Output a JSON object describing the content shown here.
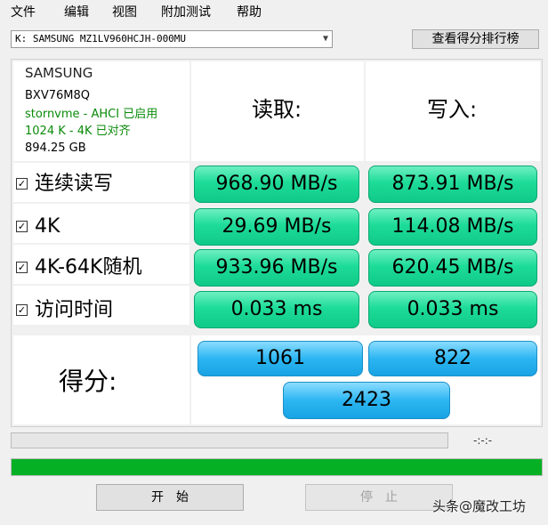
{
  "menu": {
    "file": "文件",
    "edit": "编辑",
    "view": "视图",
    "extra_tests": "附加测试",
    "help": "帮助"
  },
  "drive": {
    "selected": "K: SAMSUNG MZ1LV960HCJH-000MU"
  },
  "ranking_button": "查看得分排行榜",
  "info": {
    "brand": "SAMSUNG",
    "firmware": "BXV76M8Q",
    "driver": "stornvme - AHCI 已启用",
    "alignment": "1024 K - 4K 已对齐",
    "capacity": "894.25 GB"
  },
  "headers": {
    "read": "读取:",
    "write": "写入:"
  },
  "rows": [
    {
      "label": "连续读写",
      "checked": true,
      "read": "968.90 MB/s",
      "write": "873.91 MB/s"
    },
    {
      "label": "4K",
      "checked": true,
      "read": "29.69 MB/s",
      "write": "114.08 MB/s"
    },
    {
      "label": "4K-64K随机",
      "checked": true,
      "read": "933.96 MB/s",
      "write": "620.45 MB/s"
    },
    {
      "label": "访问时间",
      "checked": true,
      "read": "0.033 ms",
      "write": "0.033 ms"
    }
  ],
  "check_mark": "☑",
  "score": {
    "label": "得分:",
    "read": "1061",
    "write": "822",
    "total": "2423"
  },
  "elapsed": "-:-:-",
  "progress_percent": 100,
  "buttons": {
    "start": "开　始",
    "stop": "停　止"
  },
  "watermark": "头条@魔改工坊",
  "colors": {
    "result_green": "#1ddc98",
    "score_blue": "#2cb6f2",
    "progress_green": "#06b025",
    "info_green": "#0a8a0a"
  }
}
